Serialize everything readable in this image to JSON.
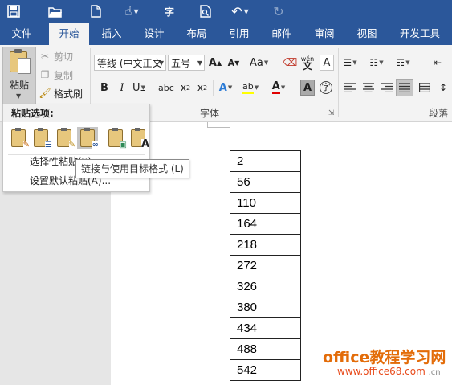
{
  "tabs": [
    "文件",
    "开始",
    "插入",
    "设计",
    "布局",
    "引用",
    "邮件",
    "审阅",
    "视图",
    "开发工具"
  ],
  "active_tab": "开始",
  "ribbon": {
    "clipboard": {
      "paste_label": "粘贴",
      "cut_label": "剪切",
      "copy_label": "复制",
      "format_painter_label": "格式刷"
    },
    "font": {
      "font_name": "等线 (中文正文",
      "font_size": "五号",
      "aa_label": "Aa",
      "wen_label": "wén",
      "a_label": "A",
      "group_label": "字体"
    },
    "paragraph": {
      "group_label": "段落"
    }
  },
  "paste_menu": {
    "header": "粘贴选项:",
    "selective_paste": "选择性粘贴(S)...",
    "set_default_paste": "设置默认粘贴(A)...",
    "tooltip": "链接与使用目标格式 (L)"
  },
  "document": {
    "table_values": [
      "2",
      "56",
      "110",
      "164",
      "218",
      "272",
      "326",
      "380",
      "434",
      "488",
      "542"
    ]
  },
  "watermark": {
    "main": "office教程学习网",
    "url": "www.office68.com"
  },
  "colors": {
    "brand": "#2b579a",
    "ribbon_bg": "#f3f3f3",
    "watermark": "#e36c09"
  }
}
